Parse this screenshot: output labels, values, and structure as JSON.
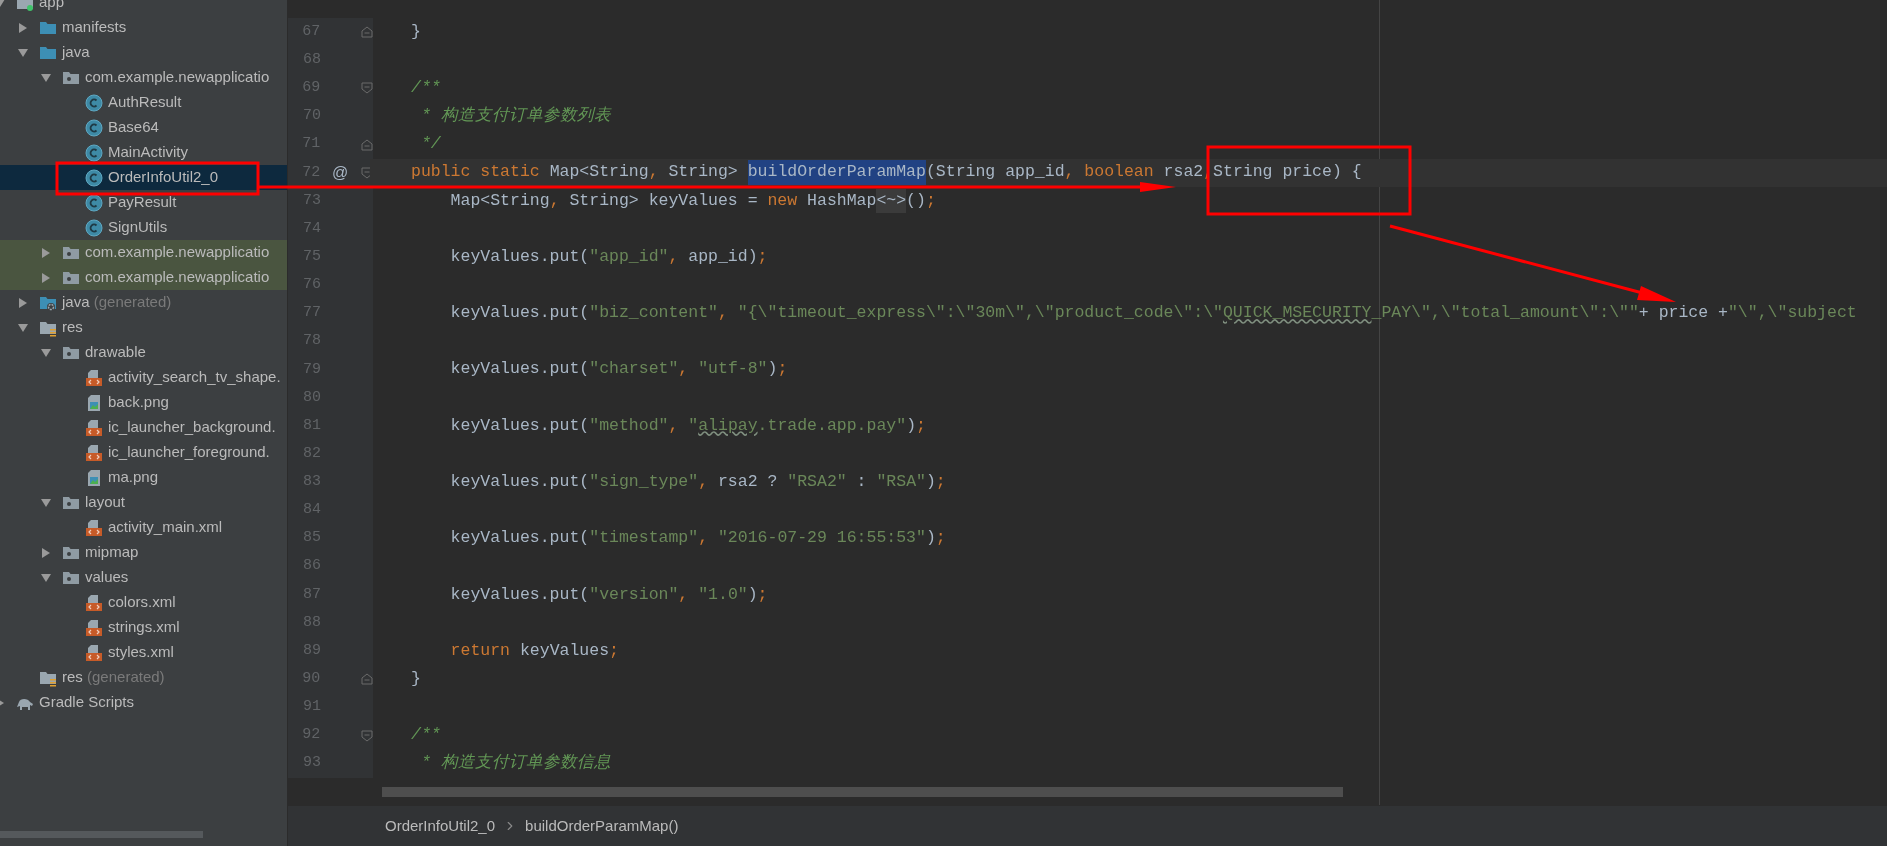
{
  "project_tree": {
    "items": [
      {
        "label": "app",
        "kind": "module",
        "expanded": true,
        "selected": false,
        "highlighted": false,
        "children": [
          {
            "label": "manifests",
            "kind": "folder",
            "expanded": false,
            "selected": false,
            "highlighted": false
          },
          {
            "label": "java",
            "kind": "folder",
            "expanded": true,
            "selected": false,
            "highlighted": false,
            "children": [
              {
                "label": "com.example.newapplicatio",
                "kind": "package",
                "expanded": true,
                "selected": false,
                "highlighted": false,
                "children": [
                  {
                    "label": "AuthResult",
                    "kind": "class",
                    "selected": false,
                    "highlighted": false
                  },
                  {
                    "label": "Base64",
                    "kind": "class",
                    "selected": false,
                    "highlighted": false
                  },
                  {
                    "label": "MainActivity",
                    "kind": "class",
                    "selected": false,
                    "highlighted": false
                  },
                  {
                    "label": "OrderInfoUtil2_0",
                    "kind": "class",
                    "selected": true,
                    "highlighted": false
                  },
                  {
                    "label": "PayResult",
                    "kind": "class",
                    "selected": false,
                    "highlighted": false
                  },
                  {
                    "label": "SignUtils",
                    "kind": "class",
                    "selected": false,
                    "highlighted": false
                  }
                ]
              },
              {
                "label": "com.example.newapplicatio",
                "kind": "package",
                "expanded": false,
                "selected": false,
                "highlighted": true
              },
              {
                "label": "com.example.newapplicatio",
                "kind": "package",
                "expanded": false,
                "selected": false,
                "highlighted": true
              }
            ]
          },
          {
            "label": "java",
            "suffix": "(generated)",
            "kind": "generated-folder",
            "expanded": false,
            "selected": false,
            "highlighted": false
          },
          {
            "label": "res",
            "kind": "res-folder",
            "expanded": true,
            "selected": false,
            "highlighted": false,
            "children": [
              {
                "label": "drawable",
                "kind": "package",
                "expanded": true,
                "selected": false,
                "highlighted": false,
                "children": [
                  {
                    "label": "activity_search_tv_shape.",
                    "kind": "xml",
                    "selected": false,
                    "highlighted": false
                  },
                  {
                    "label": "back.png",
                    "kind": "image",
                    "selected": false,
                    "highlighted": false
                  },
                  {
                    "label": "ic_launcher_background.",
                    "kind": "xml",
                    "selected": false,
                    "highlighted": false
                  },
                  {
                    "label": "ic_launcher_foreground.",
                    "kind": "xml",
                    "selected": false,
                    "highlighted": false
                  },
                  {
                    "label": "ma.png",
                    "kind": "image",
                    "selected": false,
                    "highlighted": false
                  }
                ]
              },
              {
                "label": "layout",
                "kind": "package",
                "expanded": true,
                "selected": false,
                "highlighted": false,
                "children": [
                  {
                    "label": "activity_main.xml",
                    "kind": "xml",
                    "selected": false,
                    "highlighted": false
                  }
                ]
              },
              {
                "label": "mipmap",
                "kind": "package",
                "expanded": false,
                "selected": false,
                "highlighted": false
              },
              {
                "label": "values",
                "kind": "package",
                "expanded": true,
                "selected": false,
                "highlighted": false,
                "children": [
                  {
                    "label": "colors.xml",
                    "kind": "xml",
                    "selected": false,
                    "highlighted": false
                  },
                  {
                    "label": "strings.xml",
                    "kind": "xml",
                    "selected": false,
                    "highlighted": false
                  },
                  {
                    "label": "styles.xml",
                    "kind": "xml",
                    "selected": false,
                    "highlighted": false
                  }
                ]
              }
            ]
          },
          {
            "label": "res",
            "suffix": "(generated)",
            "kind": "res-folder",
            "selected": false,
            "highlighted": false
          }
        ]
      },
      {
        "label": "Gradle Scripts",
        "kind": "gradle",
        "expanded": false,
        "selected": false,
        "highlighted": false
      }
    ]
  },
  "editor": {
    "lines": [
      {
        "number": "67",
        "current": false,
        "fold_marker": {
          "kind": "end"
        },
        "tokens": [
          {
            "text": "}",
            "kind": "p"
          }
        ]
      },
      {
        "number": "68",
        "current": false
      },
      {
        "number": "69",
        "current": false,
        "fold_marker": {
          "kind": "start"
        },
        "tokens": [
          {
            "text": "/**",
            "kind": "cm"
          }
        ]
      },
      {
        "number": "70",
        "current": false,
        "tokens": [
          {
            "text": " * 构造支付订单参数列表",
            "kind": "cm"
          }
        ]
      },
      {
        "number": "71",
        "current": false,
        "fold_marker": {
          "kind": "end"
        },
        "tokens": [
          {
            "text": " */",
            "kind": "cm"
          }
        ]
      },
      {
        "number": "72",
        "current": true,
        "marker": "@",
        "fold_marker": {
          "kind": "start"
        },
        "tokens": [
          {
            "text": "public static ",
            "kind": "kw"
          },
          {
            "text": "Map<String",
            "kind": "p"
          },
          {
            "text": ",",
            "kind": "kw"
          },
          {
            "text": " String> ",
            "kind": "p"
          },
          {
            "text": "buildOrderParamMap",
            "kind": "sel"
          },
          {
            "text": "(String app_id",
            "kind": "p"
          },
          {
            "text": ", boolean ",
            "kind": "kw"
          },
          {
            "text": "rsa2",
            "kind": "p"
          },
          {
            "text": ",",
            "kind": "kw"
          },
          {
            "text": "String price) {",
            "kind": "p"
          }
        ]
      },
      {
        "number": "73",
        "current": false,
        "tokens": [
          {
            "text": "    Map<String",
            "kind": "p"
          },
          {
            "text": ",",
            "kind": "kw"
          },
          {
            "text": " String> keyValues = ",
            "kind": "p"
          },
          {
            "text": "new ",
            "kind": "kw"
          },
          {
            "text": "HashMap",
            "kind": "p"
          },
          {
            "text": "<~>",
            "kind": "fold"
          },
          {
            "text": "()",
            "kind": "p"
          },
          {
            "text": ";",
            "kind": "kw"
          }
        ]
      },
      {
        "number": "74",
        "current": false
      },
      {
        "number": "75",
        "current": false,
        "tokens": [
          {
            "text": "    keyValues.put(",
            "kind": "p"
          },
          {
            "text": "\"app_id\"",
            "kind": "str"
          },
          {
            "text": ", ",
            "kind": "kw"
          },
          {
            "text": "app_id)",
            "kind": "p"
          },
          {
            "text": ";",
            "kind": "kw"
          }
        ]
      },
      {
        "number": "76",
        "current": false
      },
      {
        "number": "77",
        "current": false,
        "tokens": [
          {
            "text": "    keyValues.put(",
            "kind": "p"
          },
          {
            "text": "\"biz_content\"",
            "kind": "str"
          },
          {
            "text": ", ",
            "kind": "kw"
          },
          {
            "text": "\"{\\\"timeout_express\\\":\\\"30m\\\",\\\"product_code\\\":\\\"",
            "kind": "str"
          },
          {
            "text": "QUICK_MSECURITY",
            "kind": "typo"
          },
          {
            "text": "_PAY\\\",\\\"total_amount\\\":\\\"\"",
            "kind": "str"
          },
          {
            "text": "+ price +",
            "kind": "p"
          },
          {
            "text": "\"\\\",\\\"subject",
            "kind": "str"
          }
        ]
      },
      {
        "number": "78",
        "current": false
      },
      {
        "number": "79",
        "current": false,
        "tokens": [
          {
            "text": "    keyValues.put(",
            "kind": "p"
          },
          {
            "text": "\"charset\"",
            "kind": "str"
          },
          {
            "text": ", ",
            "kind": "kw"
          },
          {
            "text": "\"utf-8\"",
            "kind": "str"
          },
          {
            "text": ")",
            "kind": "p"
          },
          {
            "text": ";",
            "kind": "kw"
          }
        ]
      },
      {
        "number": "80",
        "current": false
      },
      {
        "number": "81",
        "current": false,
        "tokens": [
          {
            "text": "    keyValues.put(",
            "kind": "p"
          },
          {
            "text": "\"method\"",
            "kind": "str"
          },
          {
            "text": ", ",
            "kind": "kw"
          },
          {
            "text": "\"",
            "kind": "str"
          },
          {
            "text": "alipay",
            "kind": "typo"
          },
          {
            "text": ".trade.app.pay\"",
            "kind": "str"
          },
          {
            "text": ")",
            "kind": "p"
          },
          {
            "text": ";",
            "kind": "kw"
          }
        ]
      },
      {
        "number": "82",
        "current": false
      },
      {
        "number": "83",
        "current": false,
        "tokens": [
          {
            "text": "    keyValues.put(",
            "kind": "p"
          },
          {
            "text": "\"sign_type\"",
            "kind": "str"
          },
          {
            "text": ", ",
            "kind": "kw"
          },
          {
            "text": "rsa2 ? ",
            "kind": "p"
          },
          {
            "text": "\"RSA2\"",
            "kind": "str"
          },
          {
            "text": " : ",
            "kind": "p"
          },
          {
            "text": "\"RSA\"",
            "kind": "str"
          },
          {
            "text": ")",
            "kind": "p"
          },
          {
            "text": ";",
            "kind": "kw"
          }
        ]
      },
      {
        "number": "84",
        "current": false
      },
      {
        "number": "85",
        "current": false,
        "tokens": [
          {
            "text": "    keyValues.put(",
            "kind": "p"
          },
          {
            "text": "\"timestamp\"",
            "kind": "str"
          },
          {
            "text": ", ",
            "kind": "kw"
          },
          {
            "text": "\"2016-07-29 16:55:53\"",
            "kind": "str"
          },
          {
            "text": ")",
            "kind": "p"
          },
          {
            "text": ";",
            "kind": "kw"
          }
        ]
      },
      {
        "number": "86",
        "current": false
      },
      {
        "number": "87",
        "current": false,
        "tokens": [
          {
            "text": "    keyValues.put(",
            "kind": "p"
          },
          {
            "text": "\"version\"",
            "kind": "str"
          },
          {
            "text": ", ",
            "kind": "kw"
          },
          {
            "text": "\"1.0\"",
            "kind": "str"
          },
          {
            "text": ")",
            "kind": "p"
          },
          {
            "text": ";",
            "kind": "kw"
          }
        ]
      },
      {
        "number": "88",
        "current": false
      },
      {
        "number": "89",
        "current": false,
        "tokens": [
          {
            "text": "    return",
            "kind": "kw"
          },
          {
            "text": " keyValues",
            "kind": "p"
          },
          {
            "text": ";",
            "kind": "kw"
          }
        ]
      },
      {
        "number": "90",
        "current": false,
        "fold_marker": {
          "kind": "end"
        },
        "tokens": [
          {
            "text": "}",
            "kind": "p"
          }
        ]
      },
      {
        "number": "91",
        "current": false
      },
      {
        "number": "92",
        "current": false,
        "fold_marker": {
          "kind": "start"
        },
        "tokens": [
          {
            "text": "/**",
            "kind": "cm"
          }
        ]
      },
      {
        "number": "93",
        "current": false,
        "tokens": [
          {
            "text": " * 构造支付订单参数信息",
            "kind": "cm"
          }
        ]
      }
    ]
  },
  "breadcrumbs": [
    "OrderInfoUtil2_0",
    "buildOrderParamMap()"
  ]
}
